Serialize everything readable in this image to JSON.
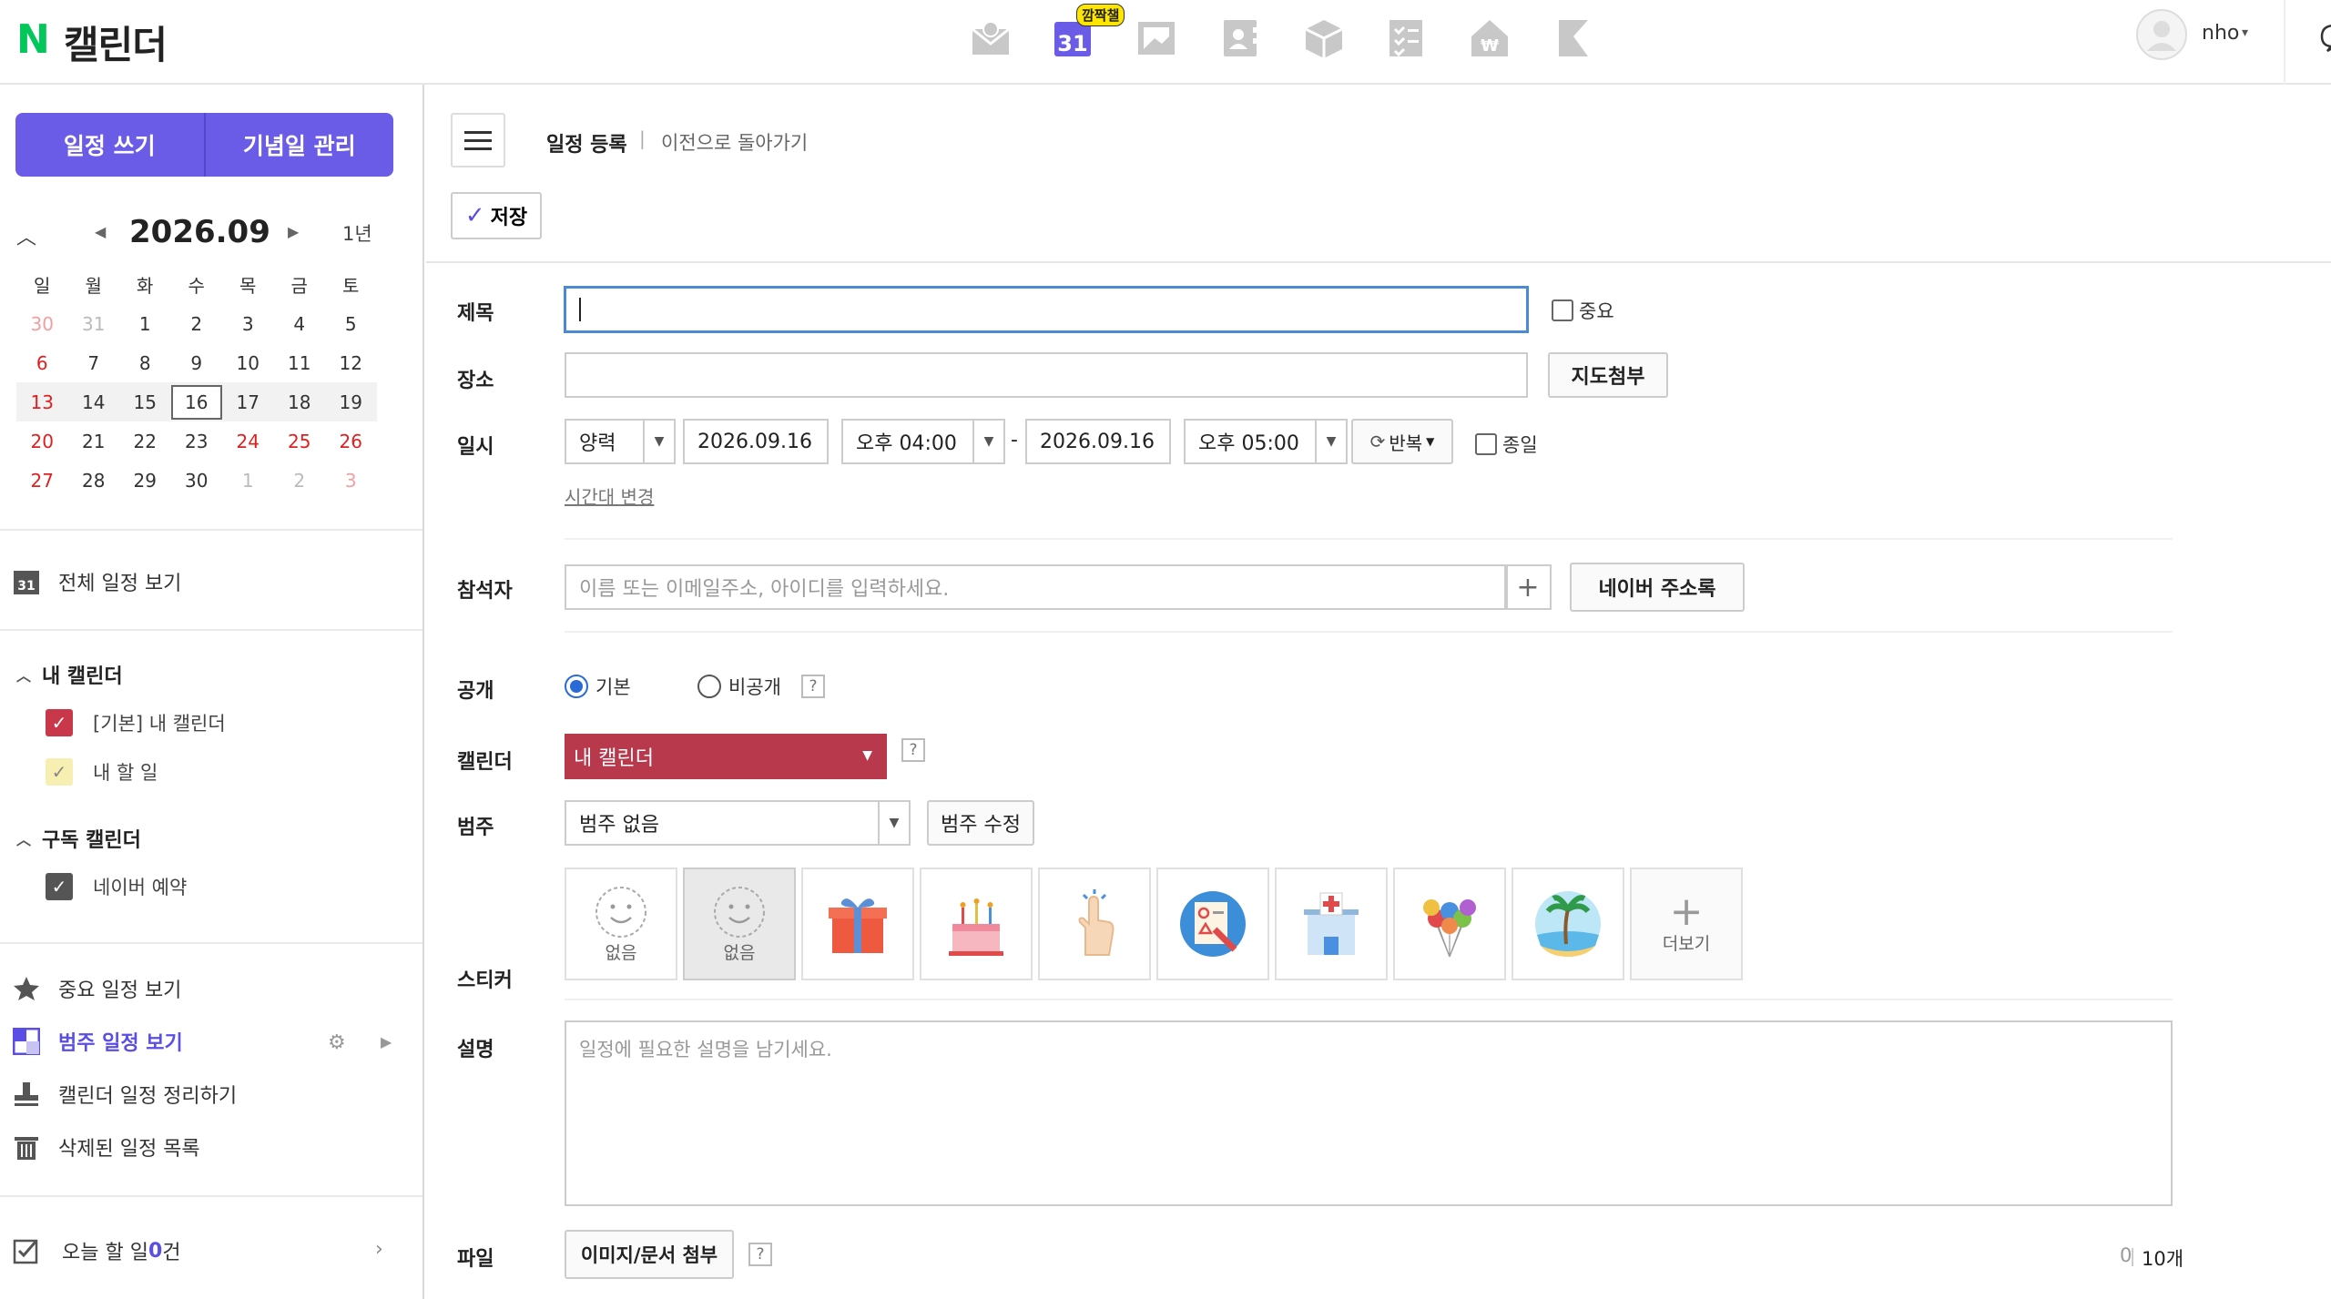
{
  "app": {
    "logo_n": "N",
    "name": "캘린더",
    "calendar_badge": "깜짝챌",
    "calendar_icon_day": "31"
  },
  "top_services": [
    "mail-icon",
    "calendar-icon",
    "photo-icon",
    "contacts-icon",
    "box-icon",
    "todo-icon",
    "pay-icon",
    "bookmark-icon"
  ],
  "user": {
    "name": "nho",
    "caret": "▾"
  },
  "sidebar": {
    "write_button": "일정 쓰기",
    "anniversary_button": "기념일 관리",
    "mini_calendar": {
      "title": "2026.09",
      "year_link": "1년",
      "weekdays": [
        "일",
        "월",
        "화",
        "수",
        "목",
        "금",
        "토"
      ],
      "weeks": [
        [
          "30",
          "31",
          "1",
          "2",
          "3",
          "4",
          "5"
        ],
        [
          "6",
          "7",
          "8",
          "9",
          "10",
          "11",
          "12"
        ],
        [
          "13",
          "14",
          "15",
          "16",
          "17",
          "18",
          "19"
        ],
        [
          "20",
          "21",
          "22",
          "23",
          "24",
          "25",
          "26"
        ],
        [
          "27",
          "28",
          "29",
          "30",
          "1",
          "2",
          "3"
        ]
      ],
      "today": "16"
    },
    "all_view": "전체 일정 보기",
    "all_view_icon_day": "31",
    "my_calendars_title": "내 캘린더",
    "my_calendars": [
      "[기본] 내 캘린더",
      "내 할 일"
    ],
    "subscribed_title": "구독 캘린더",
    "subscribed": [
      "네이버 예약"
    ],
    "menu": {
      "important": "중요 일정 보기",
      "category": "범주 일정 보기",
      "organize": "캘린더 일정 정리하기",
      "deleted": "삭제된 일정 목록"
    },
    "today_todo": {
      "prefix": "오늘 할 일 ",
      "count": "0",
      "suffix": "건"
    }
  },
  "main": {
    "breadcrumb_title": "일정 등록",
    "breadcrumb_sep": "|",
    "back_link": "이전으로 돌아가기",
    "save_label": "저장",
    "fields": {
      "title_label": "제목",
      "title_value": "",
      "important_label": "중요",
      "place_label": "장소",
      "place_value": "",
      "map_button": "지도첨부",
      "datetime_label": "일시",
      "calendar_type": "양력",
      "start_date": "2026.09.16",
      "start_time": "오후 04:00",
      "range_sep": "-",
      "end_date": "2026.09.16",
      "end_time": "오후 05:00",
      "repeat_label": "반복",
      "allday_label": "종일",
      "timezone_link": "시간대 변경",
      "attendees_label": "참석자",
      "attendees_placeholder": "이름 또는 이메일주소, 아이디를 입력하세요.",
      "plus": "+",
      "address_book_button": "네이버 주소록",
      "visibility_label": "공개",
      "visibility_default": "기본",
      "visibility_private": "비공개",
      "help_mark": "?",
      "calendar_label": "캘린더",
      "calendar_value": "내 캘린더",
      "category_label": "범주",
      "category_value": "범주 없음",
      "category_edit_button": "범주 수정",
      "sticker_label": "스티커",
      "stickers": [
        "없음",
        "없음",
        "gift-icon",
        "birthday-cake-icon",
        "pointing-hand-icon",
        "study-icon",
        "hospital-icon",
        "balloons-icon",
        "beach-icon"
      ],
      "sticker_more": "더보기",
      "description_label": "설명",
      "description_placeholder": "일정에 필요한 설명을 남기세요.",
      "file_label": "파일",
      "file_button": "이미지/문서 첨부",
      "file_count": "0",
      "file_max": "10개"
    }
  },
  "colors": {
    "accent": "#6b5ce7",
    "calendar_red": "#b8394b",
    "holiday": "#e02020",
    "focus": "#4a8ad4"
  }
}
